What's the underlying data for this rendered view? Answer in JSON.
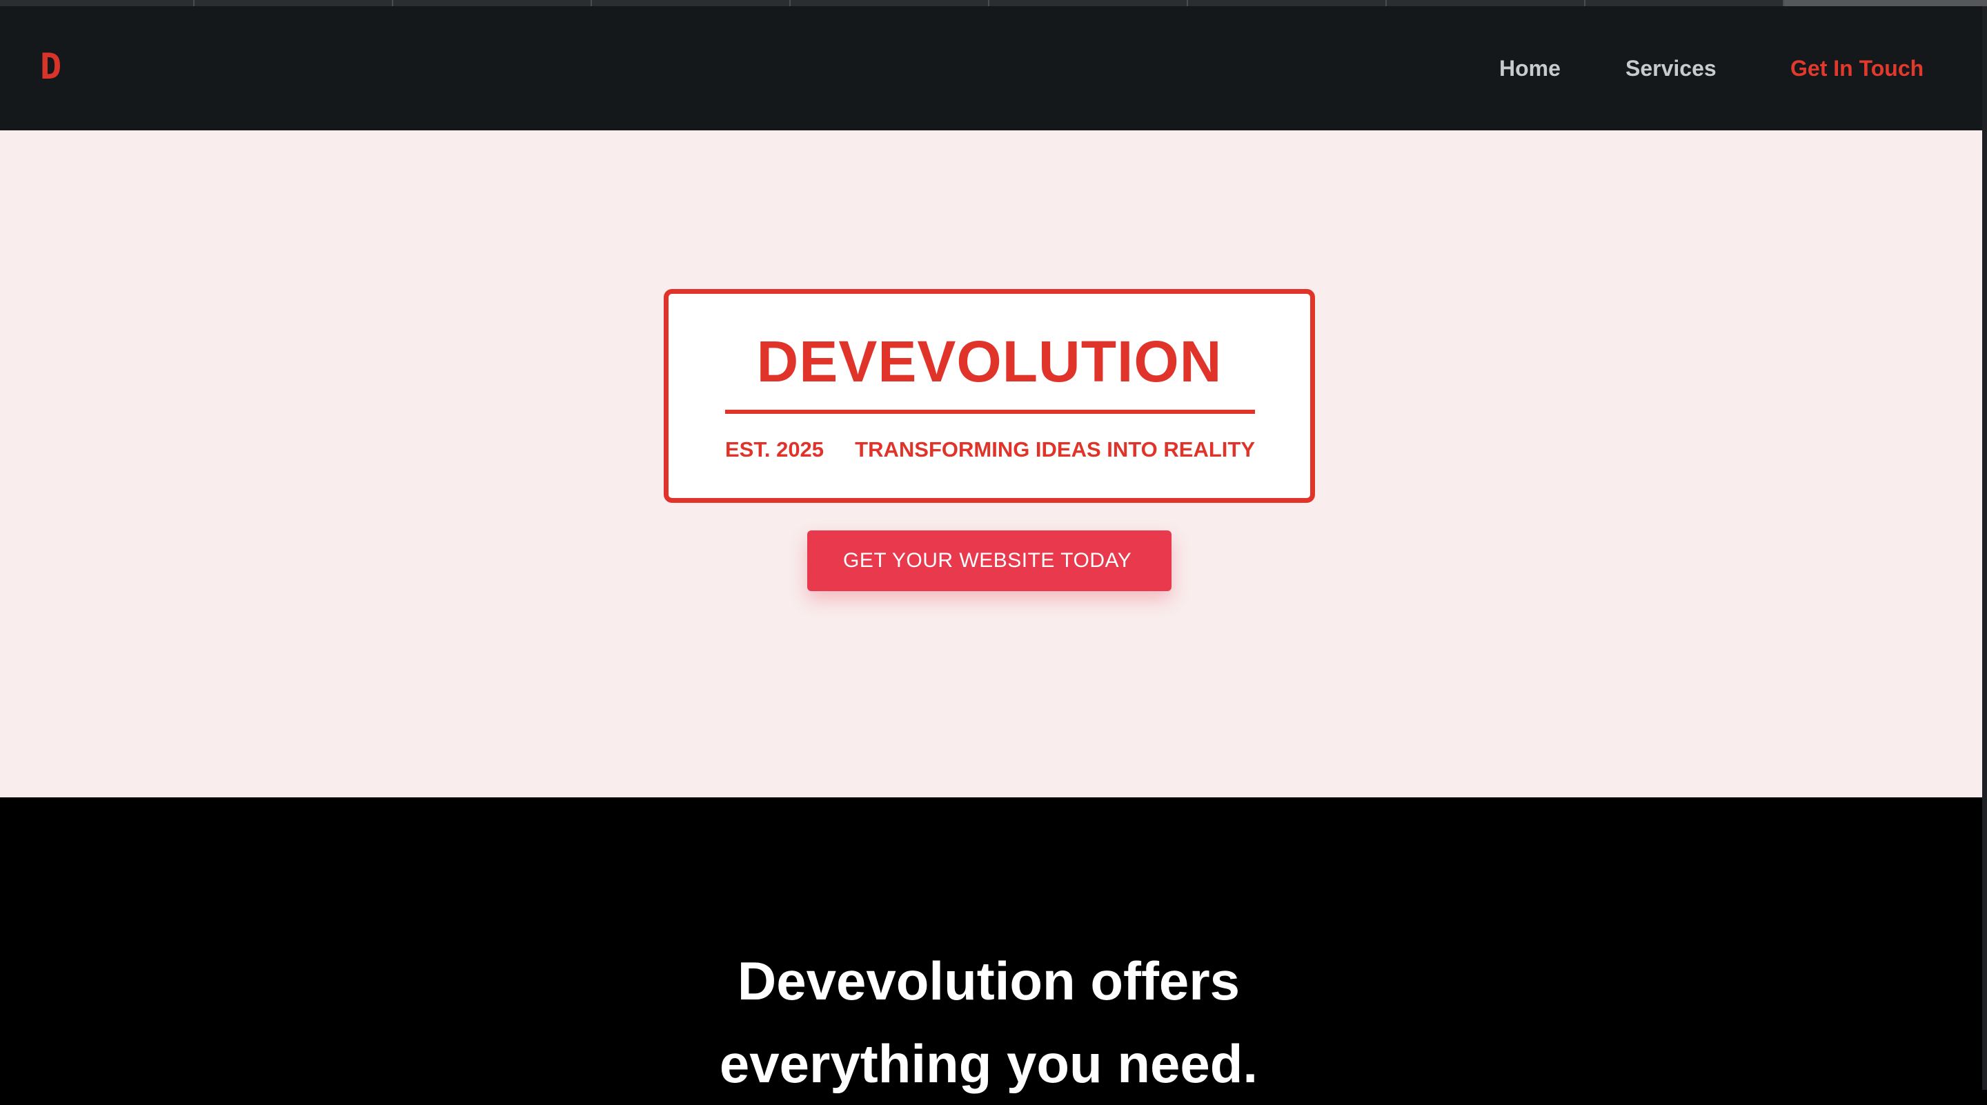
{
  "header": {
    "logo": "D",
    "nav": {
      "home": "Home",
      "services": "Services",
      "contact": "Get In Touch"
    }
  },
  "hero": {
    "brand_title": "DEVEVOLUTION",
    "established": "EST. 2025",
    "tagline": "TRANSFORMING IDEAS INTO REALITY",
    "cta_label": "GET YOUR WEBSITE TODAY"
  },
  "offers": {
    "title_line1": "Devevolution offers",
    "title_line2": "everything you need."
  },
  "colors": {
    "accent_red": "#e0342b",
    "cta_red": "#e8394d",
    "nav_bg": "#14181b",
    "hero_bg": "#f9eded",
    "section_bg": "#000000"
  }
}
